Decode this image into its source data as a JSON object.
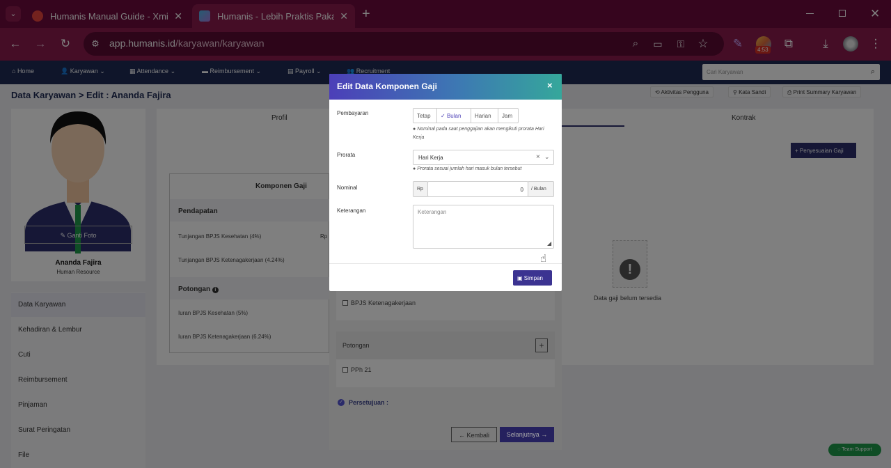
{
  "browser": {
    "tabs": [
      {
        "title": "Humanis Manual Guide - Xmind",
        "close": "✕"
      },
      {
        "title": "Humanis - Lebih Praktis Pakai Humanis",
        "close": "✕"
      }
    ],
    "new_tab": "+",
    "url_host": "app.humanis.id",
    "url_path": "/karyawan/karyawan",
    "badge": "4:53"
  },
  "nav": {
    "items": [
      "Home",
      "Karyawan",
      "Attendance",
      "Reimbursement",
      "Payroll",
      "Recruitment"
    ],
    "search_placeholder": "Cari Karyawan"
  },
  "page": {
    "breadcrumb": "Data Karyawan > Edit : Ananda Fajira",
    "actions": [
      "Aktivitas Pengguna",
      "Kata Sandi",
      "Print Summary Karyawan"
    ]
  },
  "profile": {
    "change_photo": "Ganti Foto",
    "name": "Ananda Fajira",
    "role": "Human Resource"
  },
  "side_menu": [
    "Data Karyawan",
    "Kehadiran & Lembur",
    "Cuti",
    "Reimbursement",
    "Pinjaman",
    "Surat Peringatan",
    "File"
  ],
  "tabs": {
    "left": "Profil",
    "right": "Kontrak"
  },
  "penyesuaian_label": "Penyesuaian Gaji",
  "komponen": {
    "title": "Komponen Gaji",
    "pendapatan": "Pendapatan",
    "pendapatan_items": [
      "Tunjangan BPJS Kesehatan (4%)",
      "Tunjangan BPJS Ketenagakerjaan (4.24%)"
    ],
    "potongan": "Potongan",
    "potongan_items": [
      "Iuran BPJS Kesehatan (5%)",
      "Iuran BPJS Ketenagakerjaan (6.24%)"
    ],
    "rp_prefix": "Rp"
  },
  "empty_state": "Data gaji belum tersedia",
  "middle": {
    "bpjs_ket": "BPJS Ketenagakerjaan",
    "potongan": "Potongan",
    "pph": "PPh 21",
    "persetujuan": "Persetujuan :",
    "kembali": "← Kembali",
    "selanjutnya": "Selanjutnya →"
  },
  "support": "Team Support",
  "modal": {
    "title": "Edit Data Komponen Gaji",
    "close": "×",
    "pembayaran_label": "Pembayaran",
    "options": [
      "Tetap",
      "Bulan",
      "Harian",
      "Jam"
    ],
    "selected_option": "Bulan",
    "pembayaran_hint": "Nominal pada saat penggajian akan mengikuti prorata Hari Kerja",
    "prorata_label": "Prorata",
    "prorata_value": "Hari Kerja",
    "prorata_hint": "Prorata sesuai jumlah hari masuk bulan tersebut",
    "nominal_label": "Nominal",
    "nominal_prefix": "Rp",
    "nominal_value": "0",
    "nominal_suffix": "/ Bulan",
    "keterangan_label": "Keterangan",
    "keterangan_placeholder": "Keterangan",
    "save": "Simpan"
  }
}
